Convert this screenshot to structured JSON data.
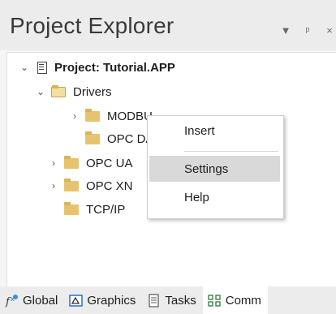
{
  "panel": {
    "title": "Project Explorer",
    "buttons": {
      "menu": "▼",
      "pin": "ᵖ",
      "close": "×"
    }
  },
  "tree": {
    "project": "Project: Tutorial.APP",
    "drivers": "Drivers",
    "modbu": "MODBU",
    "opc_da": "OPC DA",
    "opc_ua": "OPC UA",
    "opc_xml": "OPC XN",
    "tcpip": "TCP/IP"
  },
  "context_menu": {
    "items": [
      {
        "label": "Insert"
      },
      {
        "label": "Settings",
        "highlighted": true
      },
      {
        "label": "Help"
      }
    ]
  },
  "tabs": [
    {
      "label": "Global",
      "icon": "fx-icon"
    },
    {
      "label": "Graphics",
      "icon": "graphics-icon"
    },
    {
      "label": "Tasks",
      "icon": "tasks-icon"
    },
    {
      "label": "Comm",
      "icon": "comm-icon",
      "active": true
    }
  ],
  "colors": {
    "folder": "#e6c46f",
    "highlight": "#d9d9d9",
    "tabbar": "#ececec"
  }
}
